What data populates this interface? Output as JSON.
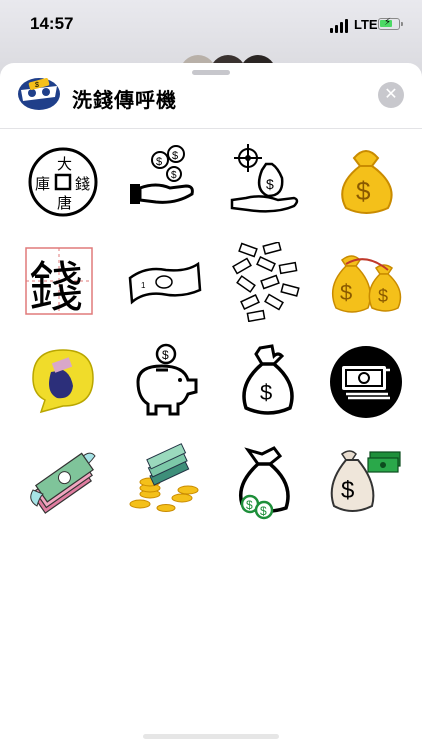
{
  "status_bar": {
    "time": "14:57",
    "network": "LTE",
    "signal_icon": "signal-bars-icon",
    "battery_icon": "battery-charging-icon"
  },
  "sheet": {
    "app_icon": "money-eye-mask-icon",
    "app_title": "洗錢傳呼機",
    "close_icon": "close-x-icon",
    "close_glyph": "✕"
  },
  "stickers": [
    {
      "icon": "ancient-coin-icon",
      "label": "大錢唐庫"
    },
    {
      "icon": "hand-receiving-coins-icon"
    },
    {
      "icon": "target-money-bag-hand-icon"
    },
    {
      "icon": "gold-money-bag-icon",
      "symbol": "$"
    },
    {
      "icon": "chinese-character-money-icon",
      "label": "錢"
    },
    {
      "icon": "banknote-outline-icon"
    },
    {
      "icon": "falling-banknotes-icon"
    },
    {
      "icon": "two-gold-money-bags-icon",
      "symbol": "$"
    },
    {
      "icon": "money-pouch-speech-bubble-icon"
    },
    {
      "icon": "piggy-bank-icon",
      "symbol": "$"
    },
    {
      "icon": "money-sack-outline-icon",
      "symbol": "$"
    },
    {
      "icon": "cash-stack-circle-icon"
    },
    {
      "icon": "flying-cash-icon"
    },
    {
      "icon": "cash-and-coins-pile-icon"
    },
    {
      "icon": "money-bag-with-coins-icon",
      "symbol": "$"
    },
    {
      "icon": "money-sack-with-cash-icon",
      "symbol": "$"
    }
  ],
  "colors": {
    "gold": "#f4c01a",
    "dark_gold": "#c98b00",
    "cash_green": "#1e8f3a",
    "black": "#000000",
    "close_grey": "#c8c8cd"
  }
}
